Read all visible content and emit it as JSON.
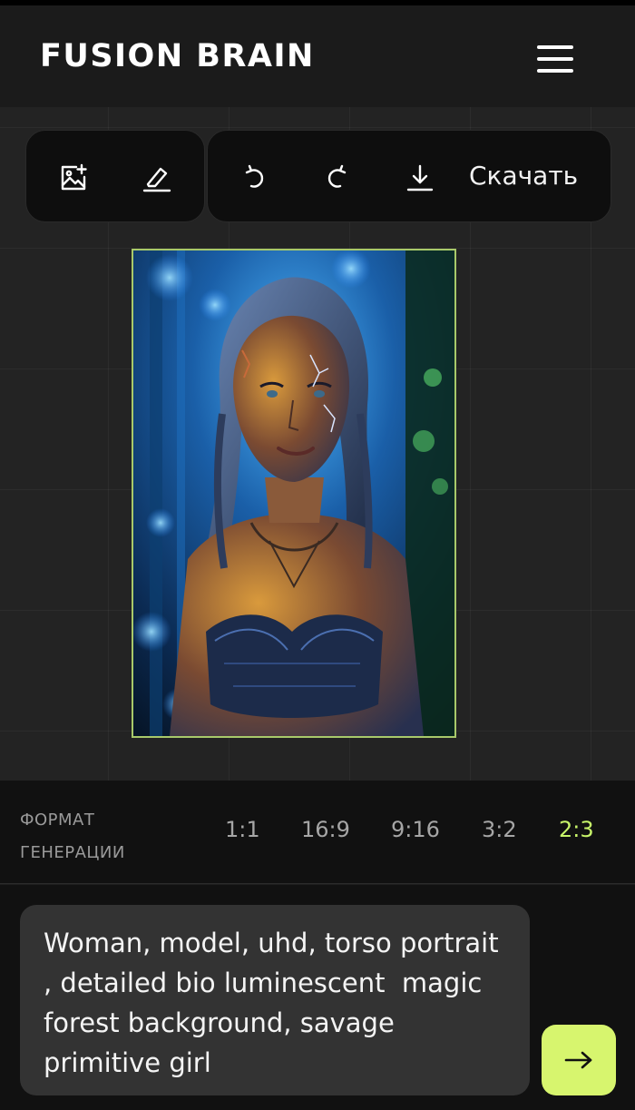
{
  "header": {
    "brand": "FUSION BRAIN"
  },
  "toolbar": {
    "download_label": "Скачать",
    "icons": [
      "add-image-icon",
      "eraser-icon",
      "undo-icon",
      "redo-icon",
      "download-icon"
    ]
  },
  "format": {
    "label_line1": "ФОРМАТ",
    "label_line2": "ГЕНЕРАЦИИ",
    "options": [
      "1:1",
      "16:9",
      "9:16",
      "3:2",
      "2:3"
    ],
    "selected": "2:3"
  },
  "prompt": {
    "text": "Woman, model, uhd, torso portrait\n, detailed bio luminescent  magic\nforest background, savage\nprimitive girl"
  },
  "colors": {
    "accent": "#d7f56e",
    "selected_ratio": "#c8f56a",
    "image_border": "#a8c96a",
    "background": "#1e1e1e"
  }
}
